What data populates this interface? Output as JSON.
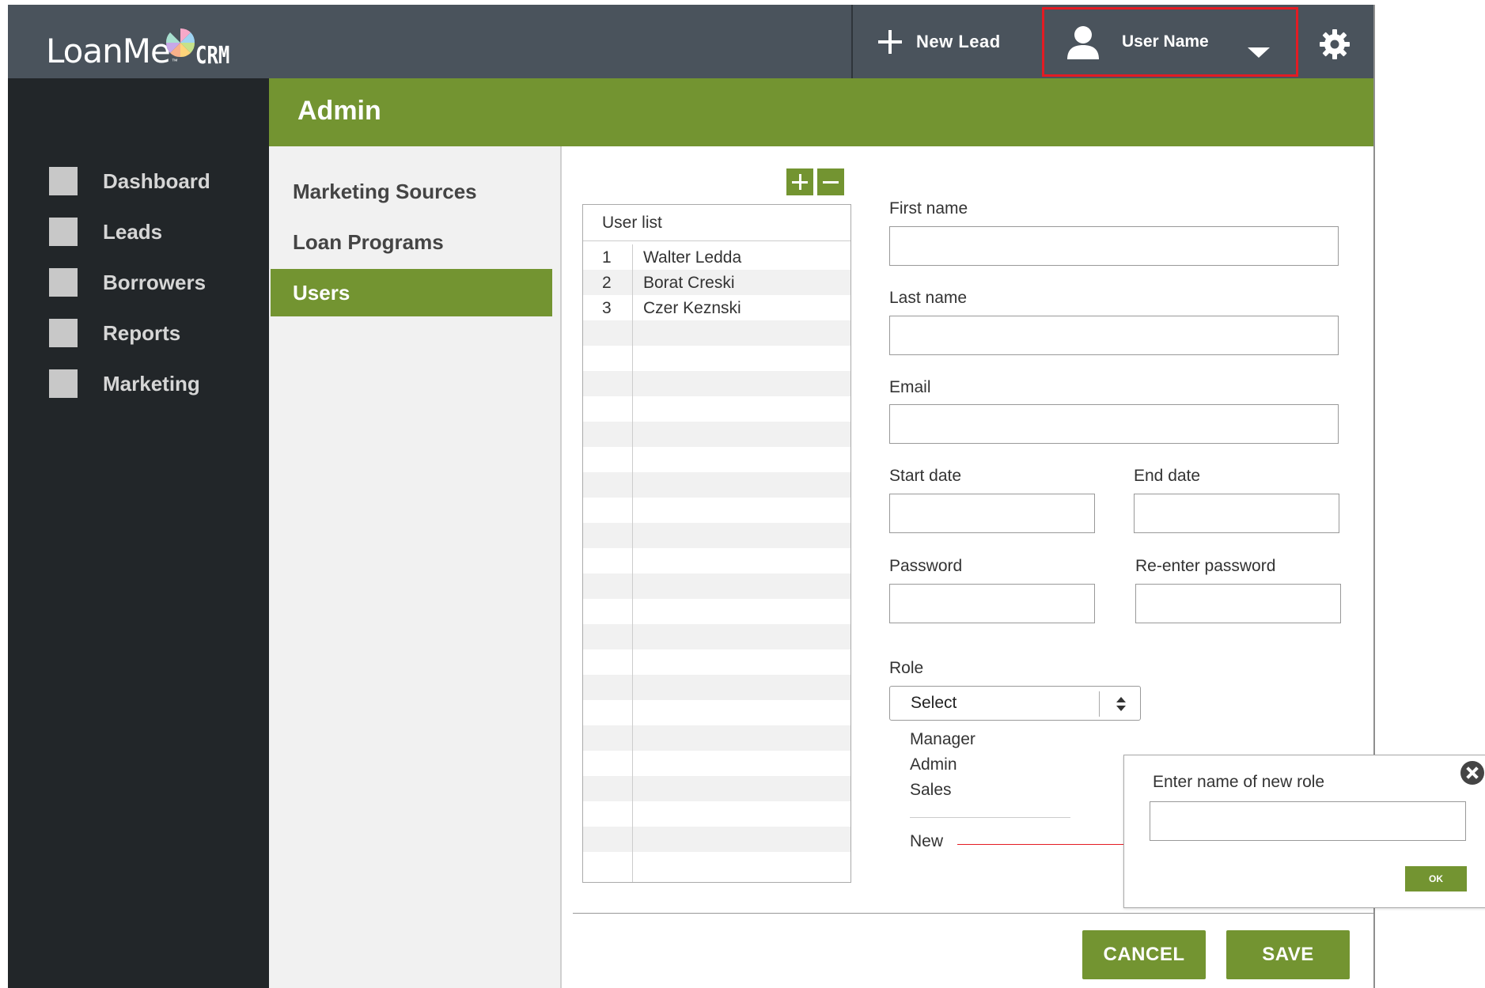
{
  "header": {
    "logo_text": "LoanMe",
    "logo_tm": "™",
    "logo_sub": "CRM",
    "new_lead_label": "New Lead",
    "user_name": "User Name"
  },
  "colors": {
    "accent_green": "#739431",
    "topbar": "#4a535c",
    "sidebar": "#222629",
    "highlight_red": "#e41b23"
  },
  "sidebar": {
    "items": [
      {
        "label": "Dashboard",
        "icon": "square-icon"
      },
      {
        "label": "Leads",
        "icon": "square-icon"
      },
      {
        "label": "Borrowers",
        "icon": "square-icon"
      },
      {
        "label": "Reports",
        "icon": "square-icon"
      },
      {
        "label": "Marketing",
        "icon": "square-icon"
      }
    ]
  },
  "page": {
    "title": "Admin"
  },
  "submenu": {
    "items": [
      {
        "label": "Marketing Sources",
        "active": false
      },
      {
        "label": "Loan Programs",
        "active": false
      },
      {
        "label": "Users",
        "active": true
      }
    ]
  },
  "user_list": {
    "header": "User list",
    "rows": [
      {
        "num": "1",
        "name": "Walter Ledda"
      },
      {
        "num": "2",
        "name": "Borat Creski"
      },
      {
        "num": "3",
        "name": "Czer Keznski"
      }
    ]
  },
  "form": {
    "first_name_label": "First name",
    "first_name_value": "",
    "last_name_label": "Last name",
    "last_name_value": "",
    "email_label": "Email",
    "email_value": "",
    "start_date_label": "Start date",
    "start_date_value": "",
    "end_date_label": "End date",
    "end_date_value": "",
    "password_label": "Password",
    "password_value": "",
    "reenter_password_label": "Re-enter password",
    "reenter_password_value": "",
    "role_label": "Role",
    "role_selected": "Select",
    "role_options": [
      "Manager",
      "Admin",
      "Sales"
    ],
    "role_new": "New"
  },
  "popup": {
    "label": "Enter name of new role",
    "value": "",
    "ok_label": "OK"
  },
  "actions": {
    "cancel_label": "CANCEL",
    "save_label": "SAVE"
  }
}
